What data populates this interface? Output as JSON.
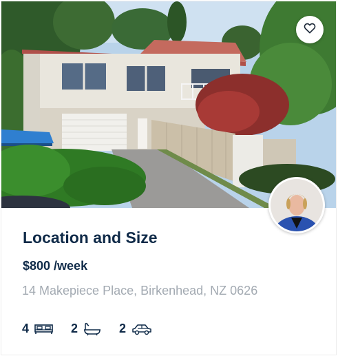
{
  "listing": {
    "title": "Location and Size",
    "price": "$800",
    "price_period": " /week",
    "address": "14 Makepiece Place, Birkenhead, NZ 0626",
    "features": {
      "bedrooms": "4",
      "bathrooms": "2",
      "parking": "2"
    }
  },
  "icons": {
    "favorite": "heart-outline",
    "bedrooms": "bed",
    "bathrooms": "bathtub",
    "parking": "car"
  },
  "colors": {
    "title": "#0f2a48",
    "address": "#a3aab2",
    "icon": "#0f2a48"
  }
}
